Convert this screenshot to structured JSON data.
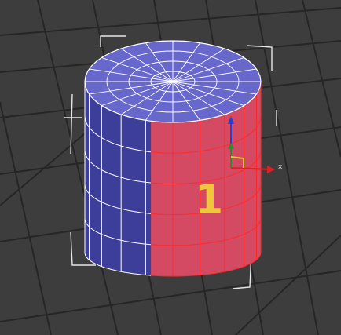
{
  "viewport": {
    "background": "#3d3d3d",
    "grid_color": "#262626"
  },
  "model": {
    "side_left_color": "#3d3d9a",
    "side_right_color": "#d44a62",
    "cap_color": "#6868cc",
    "wire_color": "#ffffff",
    "wire_selected_color": "#ff2a2a",
    "cap_segments": 20,
    "height_segments": 5
  },
  "gizmo": {
    "x_axis_label": "x",
    "x_color": "#e02020",
    "y_color": "#2e8b2e",
    "z_color": "#2040d8",
    "plane_color": "#e8c830"
  },
  "annotation": {
    "label": "1",
    "color": "#f0c63a"
  },
  "selection_bracket_color": "#e6e6e6"
}
